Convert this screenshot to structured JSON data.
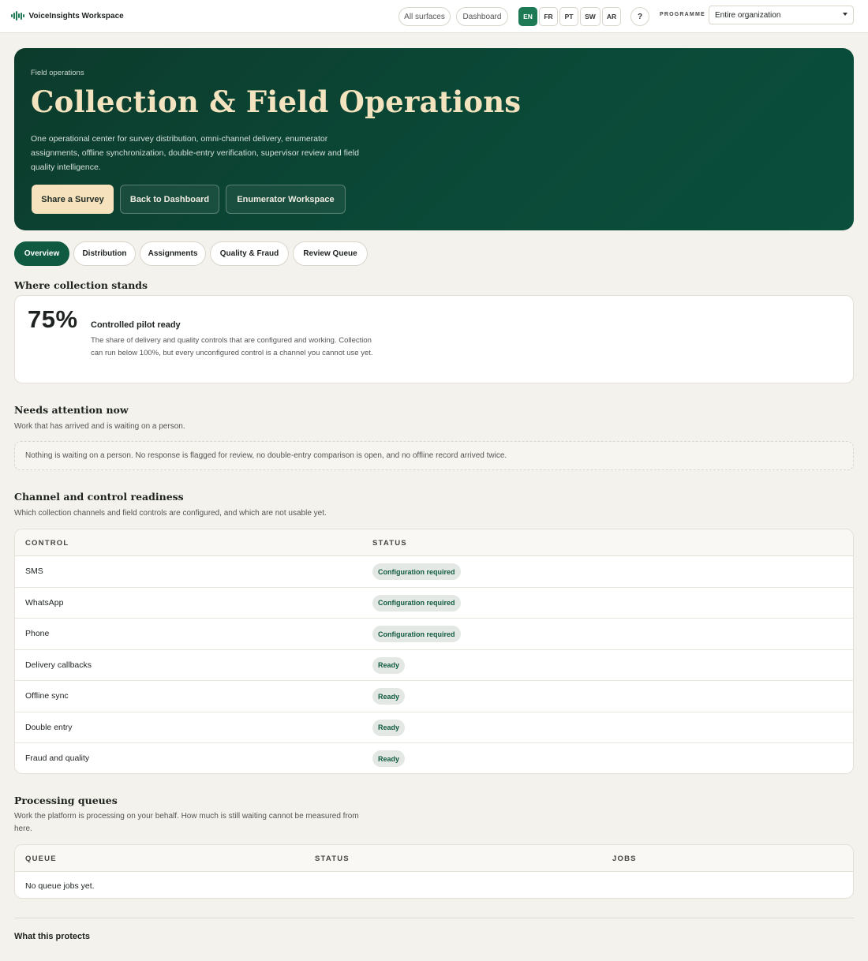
{
  "app": {
    "brand": "VoiceInsights Workspace",
    "brand_icon": "soundwave-icon",
    "accent": "#1e7a55"
  },
  "topbar": {
    "surfaces_label": "All surfaces",
    "dashboard_label": "Dashboard",
    "languages": [
      "EN",
      "FR",
      "PT",
      "SW",
      "AR"
    ],
    "active_language": "EN",
    "help_label": "?",
    "programme_label": "PROGRAMME",
    "programme_value": "Entire organization"
  },
  "hero": {
    "eyebrow": "Field operations",
    "title": "Collection & Field Operations",
    "description": "One operational center for survey distribution, omni-channel delivery, enumerator assignments, offline synchronization, double-entry verification, supervisor review and field quality intelligence.",
    "buttons": {
      "share": "Share a Survey",
      "back": "Back to Dashboard",
      "enumerator": "Enumerator Workspace"
    }
  },
  "tabs": [
    "Overview",
    "Distribution",
    "Assignments",
    "Quality & Fraud",
    "Review Queue"
  ],
  "active_tab": "Overview",
  "readiness": {
    "heading": "Where collection stands",
    "percent": "75%",
    "title": "Controlled pilot ready",
    "description": "The share of delivery and quality controls that are configured and working. Collection can run below 100%, but every unconfigured control is a channel you cannot use yet."
  },
  "attention": {
    "heading": "Needs attention now",
    "subtitle": "Work that has arrived and is waiting on a person.",
    "empty": "Nothing is waiting on a person. No response is flagged for review, no double-entry comparison is open, and no offline record arrived twice."
  },
  "channels": {
    "heading": "Channel and control readiness",
    "subtitle": "Which collection channels and field controls are configured, and which are not usable yet.",
    "columns": {
      "control": "CONTROL",
      "status": "STATUS"
    },
    "rows": [
      {
        "control": "SMS",
        "status": "Configuration required"
      },
      {
        "control": "WhatsApp",
        "status": "Configuration required"
      },
      {
        "control": "Phone",
        "status": "Configuration required"
      },
      {
        "control": "Delivery callbacks",
        "status": "Ready"
      },
      {
        "control": "Offline sync",
        "status": "Ready"
      },
      {
        "control": "Double entry",
        "status": "Ready"
      },
      {
        "control": "Fraud and quality",
        "status": "Ready"
      }
    ]
  },
  "queues": {
    "heading": "Processing queues",
    "subtitle": "Work the platform is processing on your behalf. How much is still waiting cannot be measured from here.",
    "columns": {
      "queue": "QUEUE",
      "status": "STATUS",
      "jobs": "JOBS"
    },
    "empty": "No queue jobs yet."
  },
  "footer": {
    "heading": "What this protects"
  }
}
